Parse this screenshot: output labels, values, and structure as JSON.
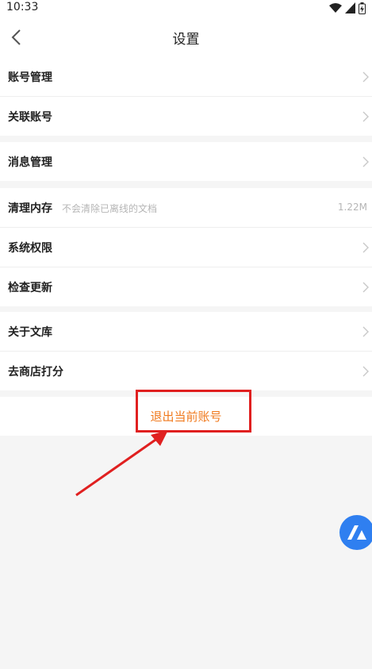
{
  "status_bar": {
    "time": "10:33"
  },
  "nav": {
    "title": "设置"
  },
  "groups": [
    {
      "rows": [
        {
          "label": "账号管理"
        },
        {
          "label": "关联账号"
        }
      ]
    },
    {
      "rows": [
        {
          "label": "消息管理"
        }
      ]
    },
    {
      "rows": [
        {
          "label": "清理内存",
          "hint": "不会清除已离线的文档",
          "value": "1.22M"
        },
        {
          "label": "系统权限"
        },
        {
          "label": "检查更新"
        }
      ]
    },
    {
      "rows": [
        {
          "label": "关于文库"
        },
        {
          "label": "去商店打分"
        }
      ]
    }
  ],
  "logout": {
    "label": "退出当前账号",
    "color": "#f07a1e"
  },
  "annotation": {
    "box_color": "#e02020"
  },
  "fab": {
    "icon": "app-logo-icon",
    "color": "#2f7ff0"
  }
}
